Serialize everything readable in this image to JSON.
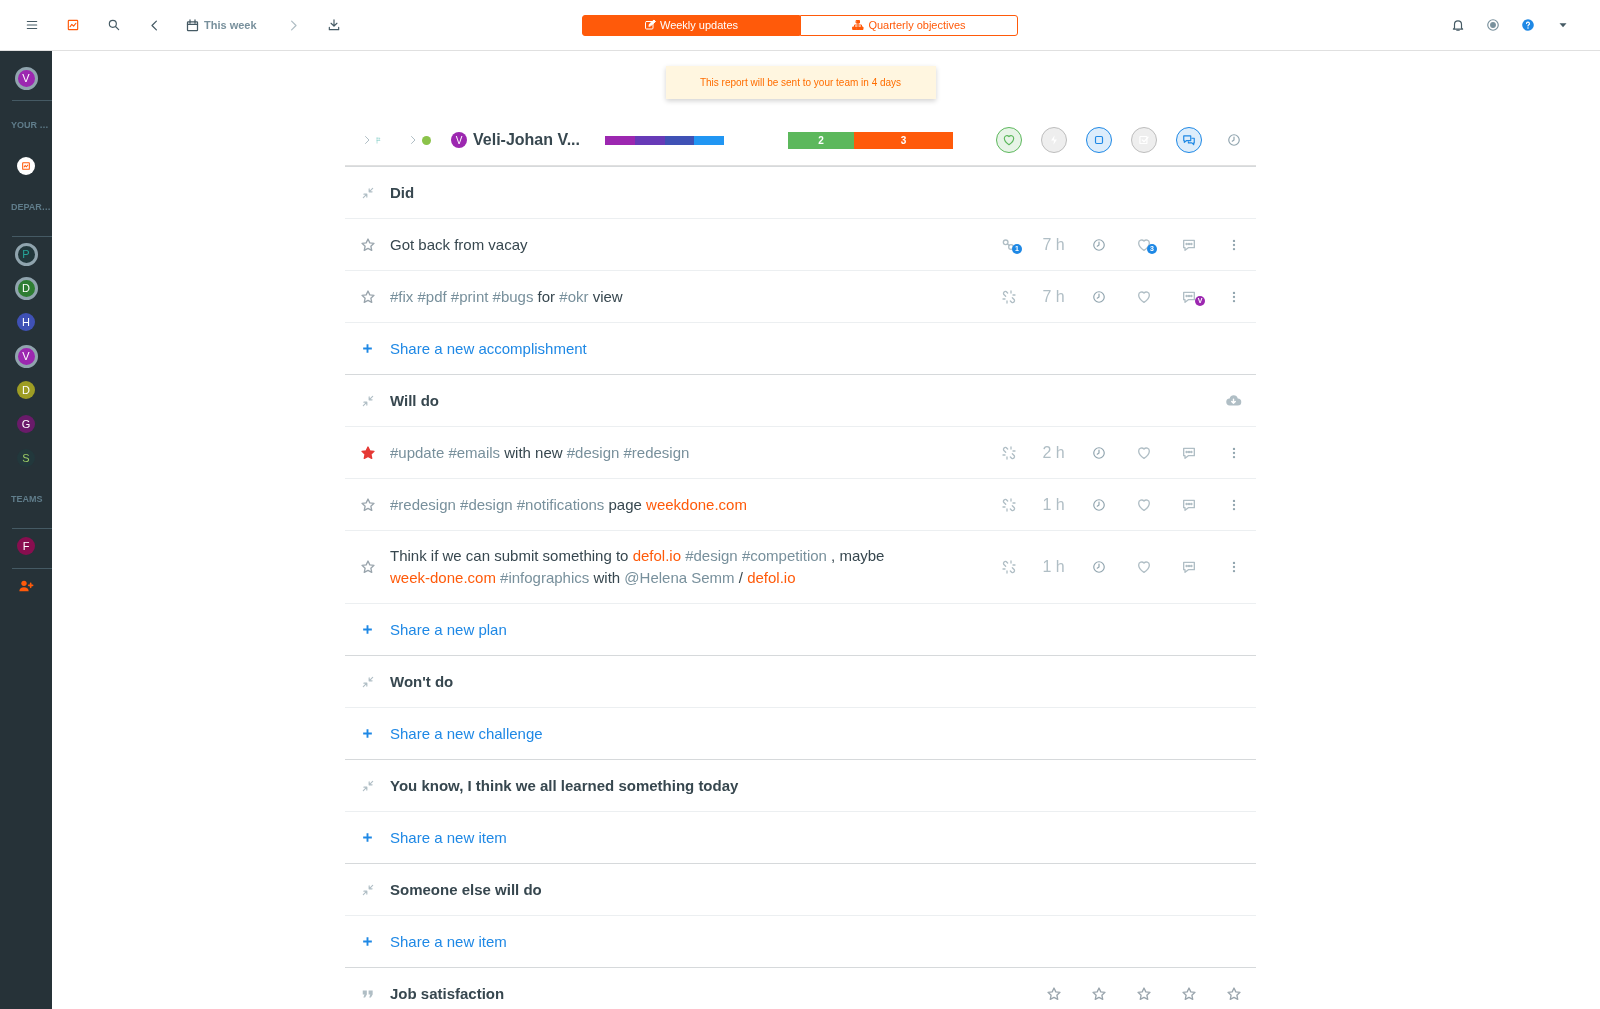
{
  "top_bar": {
    "tools": [
      {
        "kind": "menu",
        "disabled": false
      },
      {
        "kind": "chart",
        "disabled": false
      },
      {
        "kind": "search",
        "disabled": false
      },
      {
        "kind": "prev",
        "disabled": false
      },
      {
        "kind": "calendar",
        "label": "This week",
        "disabled": false
      },
      {
        "kind": "next",
        "disabled": true
      },
      {
        "kind": "download",
        "disabled": false
      }
    ],
    "tabs": [
      {
        "kind": "edit",
        "label": "Weekly updates",
        "selected": true
      },
      {
        "kind": "sitemap",
        "label": "Quarterly objectives",
        "selected": false
      }
    ],
    "right_tools": [
      {
        "kind": "bell"
      },
      {
        "kind": "target"
      },
      {
        "kind": "help"
      },
      {
        "kind": "caret"
      }
    ]
  },
  "sidebar": {
    "items": [
      {
        "kind": "avatar",
        "letter": "V",
        "color": "#9c27b0",
        "ring": true
      },
      {
        "kind": "divider"
      },
      {
        "kind": "label",
        "text": "YOUR …"
      },
      {
        "kind": "report_icon"
      },
      {
        "kind": "label",
        "text": "DEPAR…"
      },
      {
        "kind": "divider"
      },
      {
        "kind": "avatar_outline",
        "letter": "P",
        "color": "#26a69a",
        "ring": true
      },
      {
        "kind": "avatar",
        "letter": "D",
        "color": "#2e7d32",
        "ring": true
      },
      {
        "kind": "avatar",
        "letter": "H",
        "color": "#3f51b5",
        "ring": false
      },
      {
        "kind": "avatar",
        "letter": "V",
        "color": "#9c27b0",
        "ring": true
      },
      {
        "kind": "avatar",
        "letter": "D",
        "color": "#9e9d24",
        "ring": false
      },
      {
        "kind": "avatar",
        "letter": "G",
        "color": "#6a1b6a",
        "ring": false
      },
      {
        "kind": "avatar_outline",
        "letter": "S",
        "color": "#9ccc65",
        "ring": false
      },
      {
        "kind": "label",
        "text": "TEAMS"
      },
      {
        "kind": "divider"
      },
      {
        "kind": "avatar",
        "letter": "F",
        "color": "#880e4f",
        "ring": false
      },
      {
        "kind": "divider"
      },
      {
        "kind": "add_user"
      }
    ]
  },
  "notice": "This report will be sent to your team in 4 days",
  "report": {
    "header": {
      "avatar_letter": "V",
      "name": "Veli-Johan V...",
      "online": true,
      "progress": [
        {
          "color": "#9c27b0"
        },
        {
          "color": "#673ab7"
        },
        {
          "color": "#3f51b5"
        },
        {
          "color": "#2196f3"
        }
      ],
      "counts": [
        {
          "label": "2",
          "color": "#5cb85c"
        },
        {
          "label": "3",
          "color": "#ff5a0a"
        }
      ],
      "status_icons": [
        {
          "kind": "heart",
          "on": true
        },
        {
          "kind": "bolt",
          "on": false
        },
        {
          "kind": "square",
          "on": true
        },
        {
          "kind": "check",
          "on": false
        },
        {
          "kind": "chat",
          "on": true
        },
        {
          "kind": "clock",
          "on": false
        }
      ]
    },
    "sections": [
      {
        "kind": "compress",
        "title": "Did",
        "cloud": false,
        "items": [
          {
            "starred": false,
            "parts": [
              {
                "kind": "plain",
                "text": "Got back from vacay"
              }
            ],
            "link": {
              "kind": "linked",
              "badge": "1"
            },
            "hours": "7 h",
            "likes_badge": "3"
          },
          {
            "starred": false,
            "parts": [
              {
                "kind": "tag",
                "text": "#fix #pdf #print #bugs"
              },
              {
                "kind": "plain",
                "text": "for"
              },
              {
                "kind": "tag",
                "text": "#okr"
              },
              {
                "kind": "plain",
                "text": "view"
              }
            ],
            "link": {
              "kind": "unlinked"
            },
            "hours": "7 h",
            "comment_badge": {
              "letter": "V",
              "color": "#9c27b0"
            }
          }
        ],
        "share": "Share a new accomplishment"
      },
      {
        "kind": "compress",
        "title": "Will do",
        "cloud": true,
        "items": [
          {
            "starred": true,
            "parts": [
              {
                "kind": "tag",
                "text": "#update #emails"
              },
              {
                "kind": "plain",
                "text": "with new"
              },
              {
                "kind": "tag",
                "text": "#design #redesign"
              }
            ],
            "link": {
              "kind": "unlinked"
            },
            "hours": "2 h"
          },
          {
            "starred": false,
            "parts": [
              {
                "kind": "tag",
                "text": "#redesign #design #notifications"
              },
              {
                "kind": "plain",
                "text": "page"
              },
              {
                "kind": "link",
                "text": "weekdone.com"
              }
            ],
            "link": {
              "kind": "unlinked"
            },
            "hours": "1 h"
          },
          {
            "starred": false,
            "parts": [
              {
                "kind": "plain",
                "text": "Think if we can submit something to"
              },
              {
                "kind": "link",
                "text": "defol.io"
              },
              {
                "kind": "tag",
                "text": "#design #competition"
              },
              {
                "kind": "plain",
                "text": ", maybe"
              },
              {
                "kind": "link",
                "text": "week-done.com"
              },
              {
                "kind": "tag",
                "text": "#infographics"
              },
              {
                "kind": "plain",
                "text": "with"
              },
              {
                "kind": "tag",
                "text": "@Helena Semm"
              },
              {
                "kind": "plain",
                "text": "/"
              },
              {
                "kind": "link",
                "text": "defol.io"
              }
            ],
            "link": {
              "kind": "unlinked"
            },
            "hours": "1 h"
          }
        ],
        "share": "Share a new plan"
      },
      {
        "kind": "compress",
        "title": "Won't do",
        "cloud": false,
        "share": "Share a new challenge"
      },
      {
        "kind": "compress",
        "title": "You know, I think we all learned something today",
        "cloud": false,
        "share": "Share a new item"
      },
      {
        "kind": "compress",
        "title": "Someone else will do",
        "cloud": false,
        "share": "Share a new item"
      },
      {
        "kind": "quote",
        "title": "Job satisfaction",
        "stars": 0
      }
    ]
  }
}
